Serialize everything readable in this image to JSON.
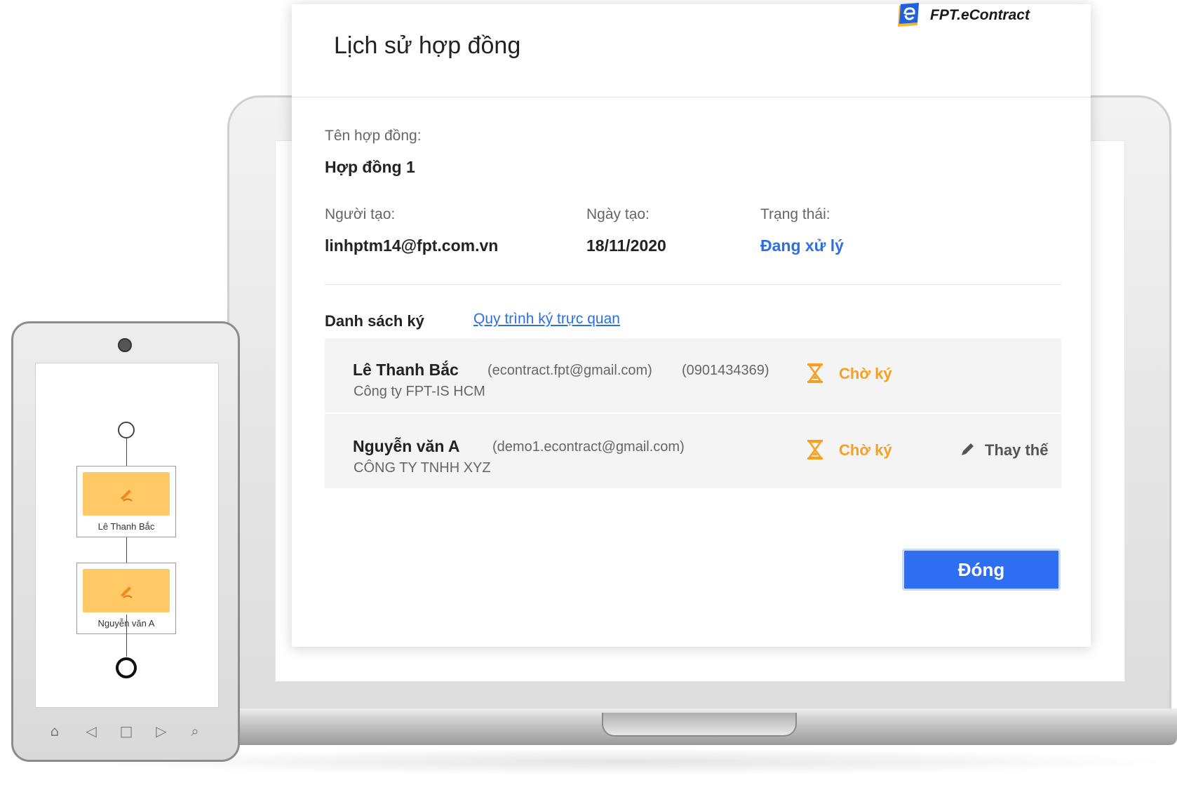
{
  "brand": {
    "name": "FPT.eContract"
  },
  "modal": {
    "title": "Lịch sử hợp đồng",
    "contract_name_label": "Tên hợp đồng:",
    "contract_name": "Hợp đồng 1",
    "creator_label": "Người tạo:",
    "creator": "linhptm14@fpt.com.vn",
    "created_date_label": "Ngày tạo:",
    "created_date": "18/11/2020",
    "status_label": "Trạng thái:",
    "status": "Đang xử lý",
    "signing_list_label": "Danh sách ký",
    "visual_flow_link": "Quy trình ký trực quan",
    "signers": [
      {
        "name": "Lê Thanh Bắc",
        "email": "(econtract.fpt@gmail.com)",
        "phone": "(0901434369)",
        "org": "Công ty FPT-IS HCM",
        "status": "Chờ ký"
      },
      {
        "name": "Nguyễn văn A",
        "email": "(demo1.econtract@gmail.com)",
        "org": "CÔNG TY TNHH XYZ",
        "status": "Chờ ký",
        "action": "Thay thế"
      }
    ],
    "close_button": "Đóng"
  },
  "tablet_flow": {
    "steps": [
      {
        "label": "Lê Thanh Bắc"
      },
      {
        "label": "Nguyễn văn A"
      }
    ]
  },
  "colors": {
    "primary": "#2f6ef0",
    "pending": "#f5a020",
    "flow_card": "#ffca66"
  },
  "icons": {
    "pending": "hourglass-icon",
    "replace": "pencil-icon",
    "logo": "econtract-logo-icon"
  }
}
